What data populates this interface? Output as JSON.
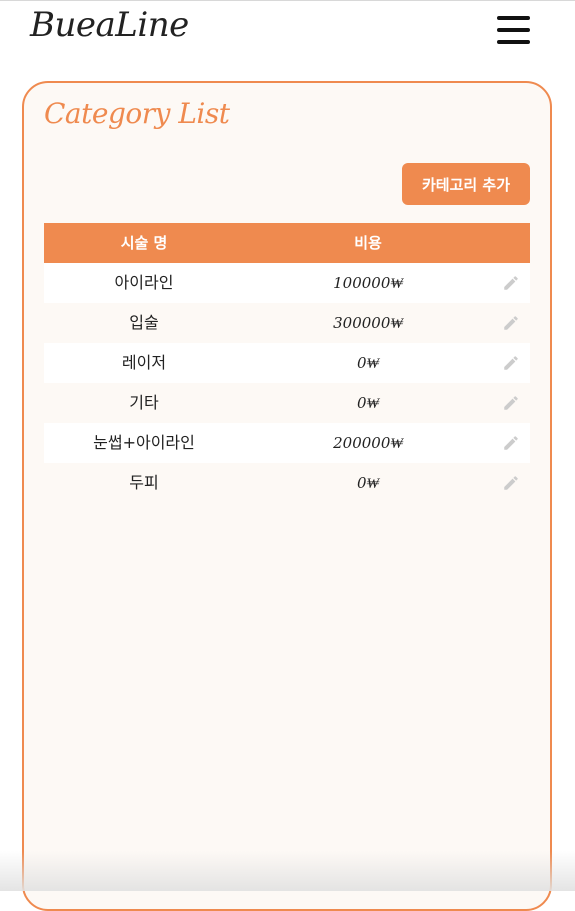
{
  "header": {
    "logo": "BueaLine",
    "menu_icon": "hamburger-menu-icon"
  },
  "card": {
    "title": "Category List",
    "add_button": "카테고리 추가",
    "columns": [
      "시술 명",
      "비용"
    ],
    "rows": [
      {
        "name": "아이라인",
        "price": "100000₩"
      },
      {
        "name": "입술",
        "price": "300000₩"
      },
      {
        "name": "레이저",
        "price": "0₩"
      },
      {
        "name": "기타",
        "price": "0₩"
      },
      {
        "name": "눈썹+아이라인",
        "price": "200000₩"
      },
      {
        "name": "두피",
        "price": "0₩"
      }
    ],
    "row_action_icon": "pencil-edit-icon"
  },
  "colors": {
    "accent": "#ef8a4f",
    "card_bg": "#fdf9f5",
    "edit_icon": "#cccccc"
  }
}
